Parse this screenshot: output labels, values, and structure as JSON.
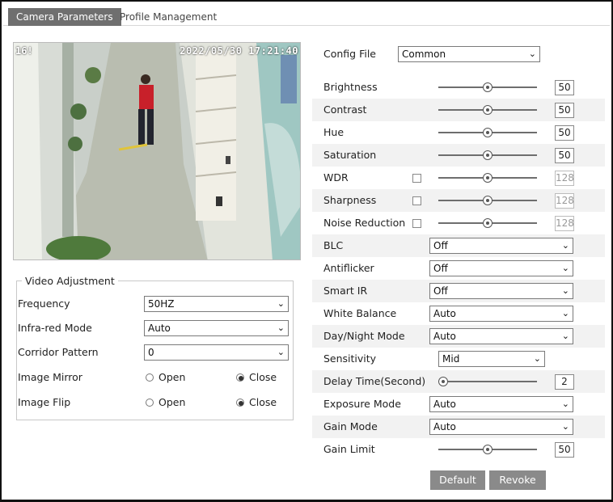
{
  "tabs": {
    "camera_parameters": "Camera Parameters",
    "profile_management": "Profile Management"
  },
  "preview": {
    "overlay_left": "16!",
    "timestamp": "2022/05/30 17:21:40"
  },
  "video_adjustment": {
    "legend": "Video Adjustment",
    "frequency": {
      "label": "Frequency",
      "value": "50HZ"
    },
    "infrared_mode": {
      "label": "Infra-red Mode",
      "value": "Auto"
    },
    "corridor_pattern": {
      "label": "Corridor Pattern",
      "value": "0"
    },
    "image_mirror": {
      "label": "Image Mirror",
      "open": "Open",
      "close": "Close",
      "selected": "Close"
    },
    "image_flip": {
      "label": "Image Flip",
      "open": "Open",
      "close": "Close",
      "selected": "Close"
    }
  },
  "config": {
    "label": "Config File",
    "value": "Common"
  },
  "sliders": {
    "brightness": {
      "label": "Brightness",
      "value": "50",
      "level": 0.5
    },
    "contrast": {
      "label": "Contrast",
      "value": "50",
      "level": 0.5
    },
    "hue": {
      "label": "Hue",
      "value": "50",
      "level": 0.5
    },
    "saturation": {
      "label": "Saturation",
      "value": "50",
      "level": 0.5
    },
    "wdr": {
      "label": "WDR",
      "value": "128",
      "level": 0.5
    },
    "sharpness": {
      "label": "Sharpness",
      "value": "128",
      "level": 0.5
    },
    "noise_reduction": {
      "label": "Noise Reduction",
      "value": "128",
      "level": 0.5
    },
    "delay_time": {
      "label": "Delay Time(Second)",
      "value": "2",
      "level": 0.05
    },
    "gain_limit": {
      "label": "Gain Limit",
      "value": "50",
      "level": 0.5
    }
  },
  "selects": {
    "blc": {
      "label": "BLC",
      "value": "Off"
    },
    "antiflicker": {
      "label": "Antiflicker",
      "value": "Off"
    },
    "smart_ir": {
      "label": "Smart IR",
      "value": "Off"
    },
    "white_balance": {
      "label": "White Balance",
      "value": "Auto"
    },
    "day_night_mode": {
      "label": "Day/Night Mode",
      "value": "Auto"
    },
    "sensitivity": {
      "label": "Sensitivity",
      "value": "Mid"
    },
    "exposure_mode": {
      "label": "Exposure Mode",
      "value": "Auto"
    },
    "gain_mode": {
      "label": "Gain Mode",
      "value": "Auto"
    }
  },
  "buttons": {
    "default": "Default",
    "revoke": "Revoke"
  },
  "icons": {
    "dropdown": "chevron-down-icon",
    "knob": "slider-knob-icon"
  }
}
